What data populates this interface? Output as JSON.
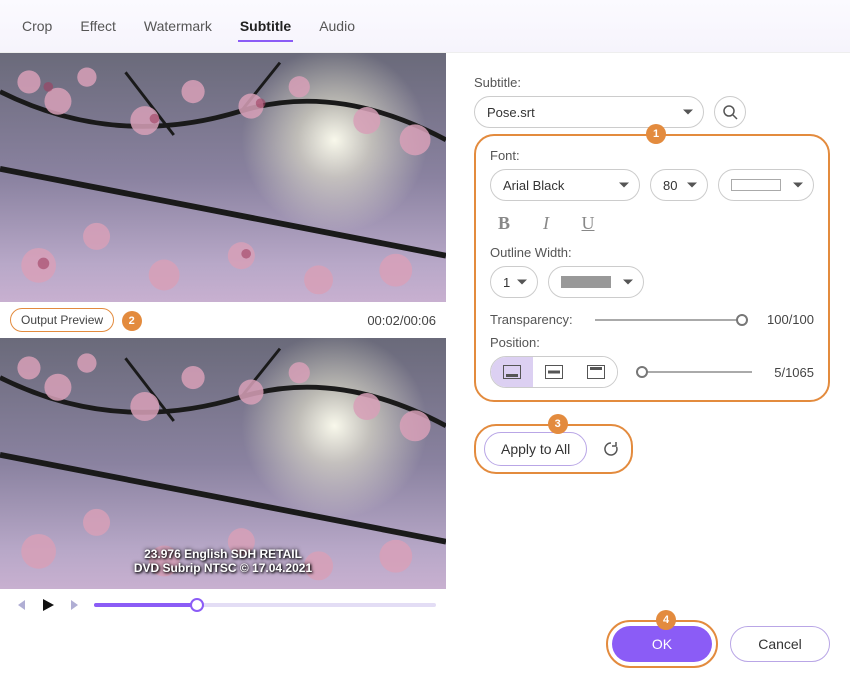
{
  "tabs": {
    "crop": "Crop",
    "effect": "Effect",
    "watermark": "Watermark",
    "subtitle": "Subtitle",
    "audio": "Audio"
  },
  "preview": {
    "label": "Output Preview",
    "marker": "2",
    "time": "00:02/00:06",
    "subtitle_line1": "23.976 English SDH RETAIL",
    "subtitle_line2": "DVD Subrip NTSC © 17.04.2021"
  },
  "panel": {
    "marker": "1",
    "subtitle_label": "Subtitle:",
    "subtitle_file": "Pose.srt",
    "font_label": "Font:",
    "font_name": "Arial Black",
    "font_size": "80",
    "outline_label": "Outline Width:",
    "outline_width": "1",
    "transparency_label": "Transparency:",
    "transparency_value": "100/100",
    "position_label": "Position:",
    "position_value": "5/1065"
  },
  "actions": {
    "apply_marker": "3",
    "apply": "Apply to All",
    "ok_marker": "4",
    "ok": "OK",
    "cancel": "Cancel"
  }
}
